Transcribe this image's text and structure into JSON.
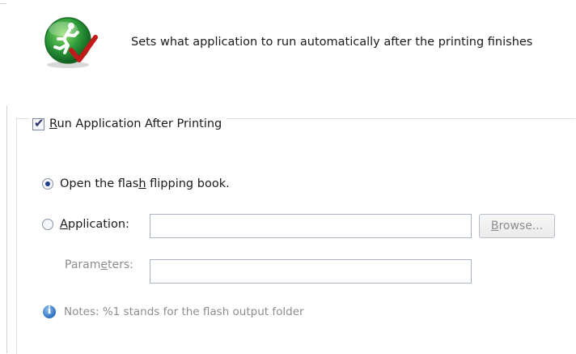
{
  "header": {
    "description": "Sets what application to run automatically after the printing finishes"
  },
  "group": {
    "checkbox_label_pre": "",
    "checkbox_label_underline": "R",
    "checkbox_label_post": "un Application After Printing",
    "checked": true
  },
  "options": {
    "open_flash_pre": "Open the flas",
    "open_flash_underline": "h",
    "open_flash_post": " flipping book.",
    "open_flash_selected": true,
    "application_pre": "",
    "application_underline": "A",
    "application_post": "pplication:",
    "application_selected": false,
    "application_value": ""
  },
  "browse": {
    "label_underline": "B",
    "label_post": "rowse..."
  },
  "parameters": {
    "label_pre": "Param",
    "label_underline": "e",
    "label_post": "ters:",
    "value": ""
  },
  "notes": {
    "text": "Notes: %1 stands for the flash output folder"
  },
  "icons": {
    "app_icon": "running-man-check-icon",
    "info_icon": "info-icon"
  },
  "colors": {
    "icon_green": "#2e9c3a",
    "check_red": "#c21a1a",
    "radio_dot": "#1d3e8a"
  }
}
